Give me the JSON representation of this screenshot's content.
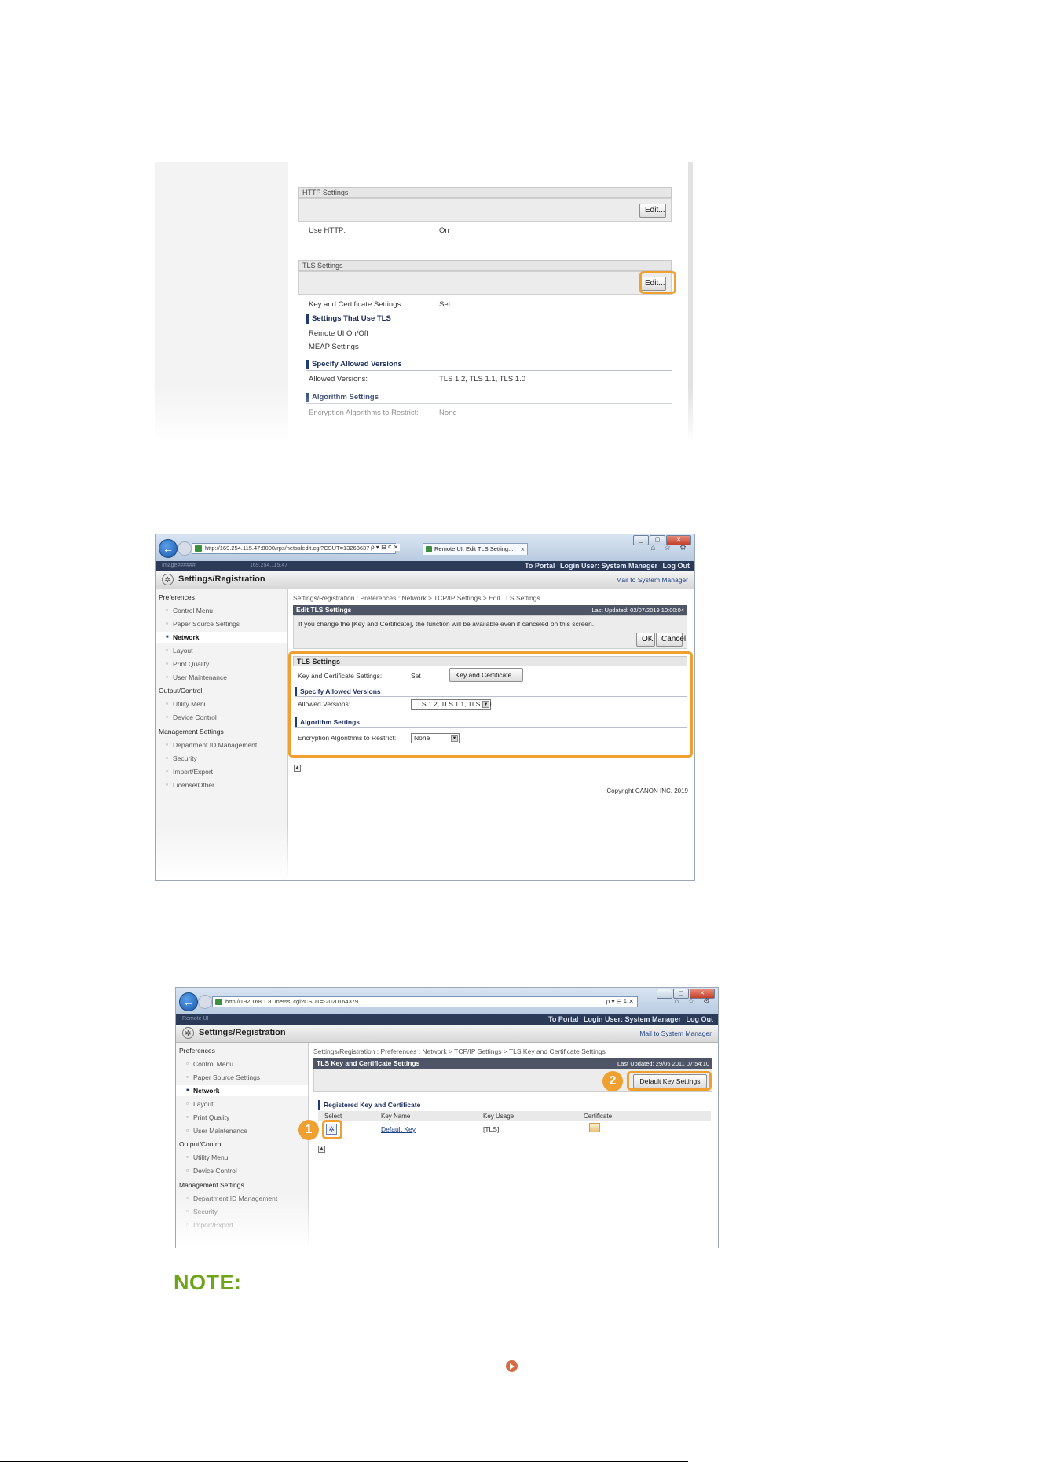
{
  "shot1": {
    "http_section": {
      "title": "HTTP Settings",
      "edit_label": "Edit...",
      "use_http_label": "Use HTTP:",
      "use_http_value": "On"
    },
    "tls_section": {
      "title": "TLS Settings",
      "edit_label": "Edit...",
      "key_cert_label": "Key and Certificate Settings:",
      "key_cert_value": "Set",
      "settings_use_tls_heading": "Settings That Use TLS",
      "remote_ui_label": "Remote UI On/Off",
      "meap_label": "MEAP Settings",
      "allowed_versions_heading": "Specify Allowed Versions",
      "allowed_versions_label": "Allowed Versions:",
      "allowed_versions_value": "TLS 1.2, TLS 1.1, TLS 1.0",
      "algorithm_heading": "Algorithm Settings",
      "encryption_label": "Encryption Algorithms to Restrict:",
      "encryption_value": "None"
    }
  },
  "shot2": {
    "browser": {
      "url": "http://169.254.115.47:8000/rps/netssledit.cgi?CSUT=13263637",
      "addr_controls": "ρ ▾ ⊟ ¢ ✕",
      "tab_title": "Remote UI: Edit TLS Setting...",
      "tab_close": "×",
      "tools_icons": "⌂ ☆ ⚙"
    },
    "header": {
      "model": "Image######",
      "ip": "169.254.115.47",
      "to_portal": "To Portal",
      "login_user": "Login User: System Manager",
      "log_out": "Log Out"
    },
    "app_title": "Settings/Registration",
    "mail_link": "Mail to System Manager",
    "sidebar": {
      "preferences": "Preferences",
      "control_menu": "Control Menu",
      "paper_source": "Paper Source Settings",
      "network": "Network",
      "layout": "Layout",
      "print_quality": "Print Quality",
      "user_maintenance": "User Maintenance",
      "output_control": "Output/Control",
      "utility_menu": "Utility Menu",
      "device_control": "Device Control",
      "management_settings": "Management Settings",
      "department_id": "Department ID Management",
      "security": "Security",
      "import_export": "Import/Export",
      "license_other": "License/Other"
    },
    "breadcrumb": "Settings/Registration : Preferences : Network > TCP/IP Settings > Edit TLS Settings",
    "page_title": "Edit TLS Settings",
    "last_updated": "Last Updated: 02/07/2019 10:00:04",
    "info_message": "If you change the [Key and Certificate], the function will be available even if canceled on this screen.",
    "ok_label": "OK",
    "cancel_label": "Cancel",
    "tls_settings_title": "TLS Settings",
    "key_cert_label": "Key and Certificate Settings:",
    "key_cert_value": "Set",
    "key_cert_button": "Key and Certificate...",
    "allowed_versions_heading": "Specify Allowed Versions",
    "allowed_versions_label": "Allowed Versions:",
    "allowed_versions_value": "TLS 1.2, TLS 1.1, TLS 1.0",
    "algorithm_heading": "Algorithm Settings",
    "encryption_label": "Encryption Algorithms to Restrict:",
    "encryption_value": "None",
    "copyright": "Copyright CANON INC. 2019"
  },
  "shot3": {
    "browser": {
      "url": "http://192.168.1.81/netssl.cgi?CSUT=-2020164379",
      "addr_controls": "ρ ▾ ⊟ ¢ ✕",
      "tools_icons": "⌂ ☆ ⚙"
    },
    "header": {
      "model": "Remote UI",
      "to_portal": "To Portal",
      "login_user": "Login User: System Manager",
      "log_out": "Log Out"
    },
    "app_title": "Settings/Registration",
    "mail_link": "Mail to System Manager",
    "sidebar": {
      "preferences": "Preferences",
      "control_menu": "Control Menu",
      "paper_source": "Paper Source Settings",
      "network": "Network",
      "layout": "Layout",
      "print_quality": "Print Quality",
      "user_maintenance": "User Maintenance",
      "output_control": "Output/Control",
      "utility_menu": "Utility Menu",
      "device_control": "Device Control",
      "management_settings": "Management Settings",
      "department_id": "Department ID Management",
      "security": "Security",
      "import_export": "Import/Export"
    },
    "breadcrumb": "Settings/Registration : Preferences : Network > TCP/IP Settings > TLS Key and Certificate Settings",
    "page_title": "TLS Key and Certificate Settings",
    "last_updated": "Last Updated: 29/06 2011 07:54:10",
    "default_key_button": "Default Key Settings",
    "registered_heading": "Registered Key and Certificate",
    "table": {
      "headers": [
        "Select",
        "Key Name",
        "Key Usage",
        "Certificate"
      ],
      "row": {
        "key_name": "Default Key",
        "key_usage": "[TLS]"
      }
    },
    "callout_1": "1",
    "callout_2": "2"
  },
  "note_title": "NOTE:",
  "colors": {
    "accent_orange": "#f0a030",
    "note_green": "#6ea51b",
    "header_navy": "#2b3a57",
    "section_blue": "#1f3a78",
    "link_icon": "#d56a43"
  }
}
